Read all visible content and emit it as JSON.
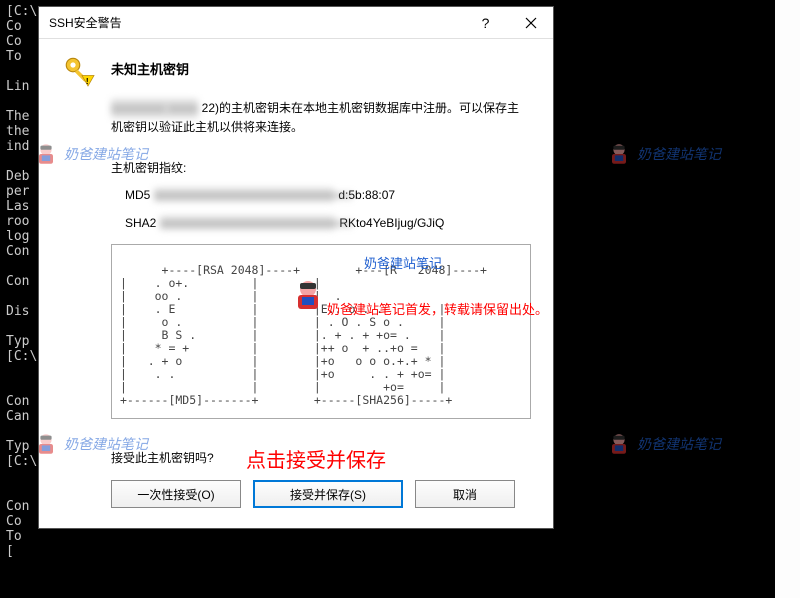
{
  "terminal": {
    "lines": "[C:\\\nCo\nCo\nTo\n\nLin\n\nThe\nthe\nind\n\nDeb\nper\nLas\nroo\nlog\nCon\n\nCon\n\nDis\n\nTyp\n[C:\\\n\n\nCon\nCan\n\nTyp\n[C:\\\n\n\nCon\nCo\nTo\n[\n"
  },
  "dialog": {
    "title": "SSH安全警告",
    "heading": "未知主机密钥",
    "body_line1_prefix": "xxxxxxxxx xxxxx",
    "body_line1_suffix": " 22)的主机密钥未在本地主机密钥数据库中注册。可以保存主",
    "body_line2": "机密钥以验证此主机以供将来连接。",
    "fingerprint_label": "主机密钥指纹:",
    "md5_label": "MD5",
    "md5_redacted": "xxxxxxxxxxxxxxxxxxxxxxxxxxxxxxxxx",
    "md5_suffix": "d:5b:88:07",
    "sha_label": "SHA2",
    "sha_redacted": "xxxxxxxxxxxxxxxxxxxxxxxxxxxxxxxx",
    "sha_suffix": "RKto4YeBIjug/GJiQ",
    "ascii_art": "+----[RSA 2048]----+        +---[R   2048]----+\n|    . o+.         |        |\n|    oo .          |        |  .\n|    . E           |        |E.. o . .        |\n|     o .          |        | . O . S o .     |\n|     B S .        |        |. + . + +o= .    |\n|    * = +         |        |++ o  + ..+o =   |\n|   . + o          |        |+o   o o o.+.+ * |\n|    . .           |        |+o     . . + +o= |\n|                  |        |         +o=     |\n+------[MD5]-------+        +-----[SHA256]-----+",
    "question": "接受此主机密钥吗?",
    "btn_once": "一次性接受(O)",
    "btn_accept_save": "接受并保存(S)",
    "btn_cancel": "取消"
  },
  "annotations": {
    "blue_text": "奶爸建站笔记",
    "red_line": "奶爸建站笔记首发，转载请保留出处。",
    "instruction": "点击接受并保存",
    "watermark": "奶爸建站笔记"
  }
}
